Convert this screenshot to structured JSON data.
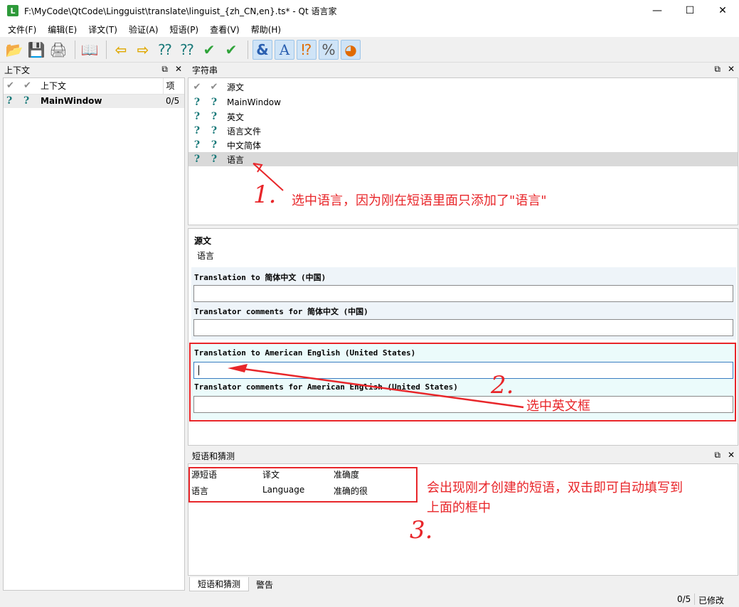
{
  "window": {
    "title": "F:\\MyCode\\QtCode\\Lingguist\\translate\\linguist_{zh_CN,en}.ts* - Qt 语言家",
    "app_icon_letter": "L",
    "minimize": "—",
    "maximize": "☐",
    "close": "✕"
  },
  "menu": [
    "文件(F)",
    "编辑(E)",
    "译文(T)",
    "验证(A)",
    "短语(P)",
    "查看(V)",
    "帮助(H)"
  ],
  "toolbar": {
    "icons": [
      "open-icon",
      "save-icon",
      "print-icon",
      "phrasebook-icon",
      "prev-icon",
      "next-icon",
      "prev-unfinished-icon",
      "next-unfinished-icon",
      "done-icon",
      "done-next-icon",
      "accelerator-check-icon",
      "punctuation-check-icon",
      "phrase-check-icon",
      "placemarker-check-icon",
      "surrounding-whitespace-check-icon"
    ],
    "glyphs": [
      "📂",
      "💾",
      "🖨",
      "📖",
      "⇦",
      "⇨",
      "⁇",
      "⁇",
      "✔",
      "✔",
      "&",
      "A",
      "⁉",
      "%",
      "◕"
    ]
  },
  "context_pane": {
    "title": "上下文",
    "headers": {
      "col3": "上下文",
      "col4": "项"
    },
    "rows": [
      {
        "name": "MainWindow",
        "count": "0/5"
      }
    ]
  },
  "strings_pane": {
    "title": "字符串",
    "header_source": "源文",
    "rows": [
      "MainWindow",
      "英文",
      "语言文件",
      "中文简体",
      "语言"
    ],
    "selected_index": 4
  },
  "editor": {
    "source_label": "源文",
    "source_text": "语言",
    "zh_translation_label": "Translation to 简体中文 (中国)",
    "zh_comments_label": "Translator comments for 简体中文 (中国)",
    "en_translation_label": "Translation to American English (United States)",
    "en_comments_label": "Translator comments for American English (United States)"
  },
  "phrases_pane": {
    "title": "短语和猜测",
    "headers": [
      "源短语",
      "译文",
      "准确度"
    ],
    "rows": [
      {
        "source": "语言",
        "translation": "Language",
        "accuracy": "准确的很"
      }
    ]
  },
  "bottom_tabs": [
    "短语和猜测",
    "警告"
  ],
  "status": {
    "progress": "0/5",
    "modified": "已修改"
  },
  "pane_controls": {
    "float": "⧉",
    "close": "✕"
  },
  "annotations": {
    "note1": "选中语言，因为刚在短语里面只添加了\"语言\"",
    "note2": "选中英文框",
    "note3_line1": "会出现刚才创建的短语，双击即可自动填写到",
    "note3_line2": "上面的框中",
    "num1": "1.",
    "num2": "2.",
    "num3": "3."
  },
  "colors": {
    "annotation": "#e8262a",
    "selection": "#d9d9d9",
    "focus": "#3a7cc1"
  }
}
